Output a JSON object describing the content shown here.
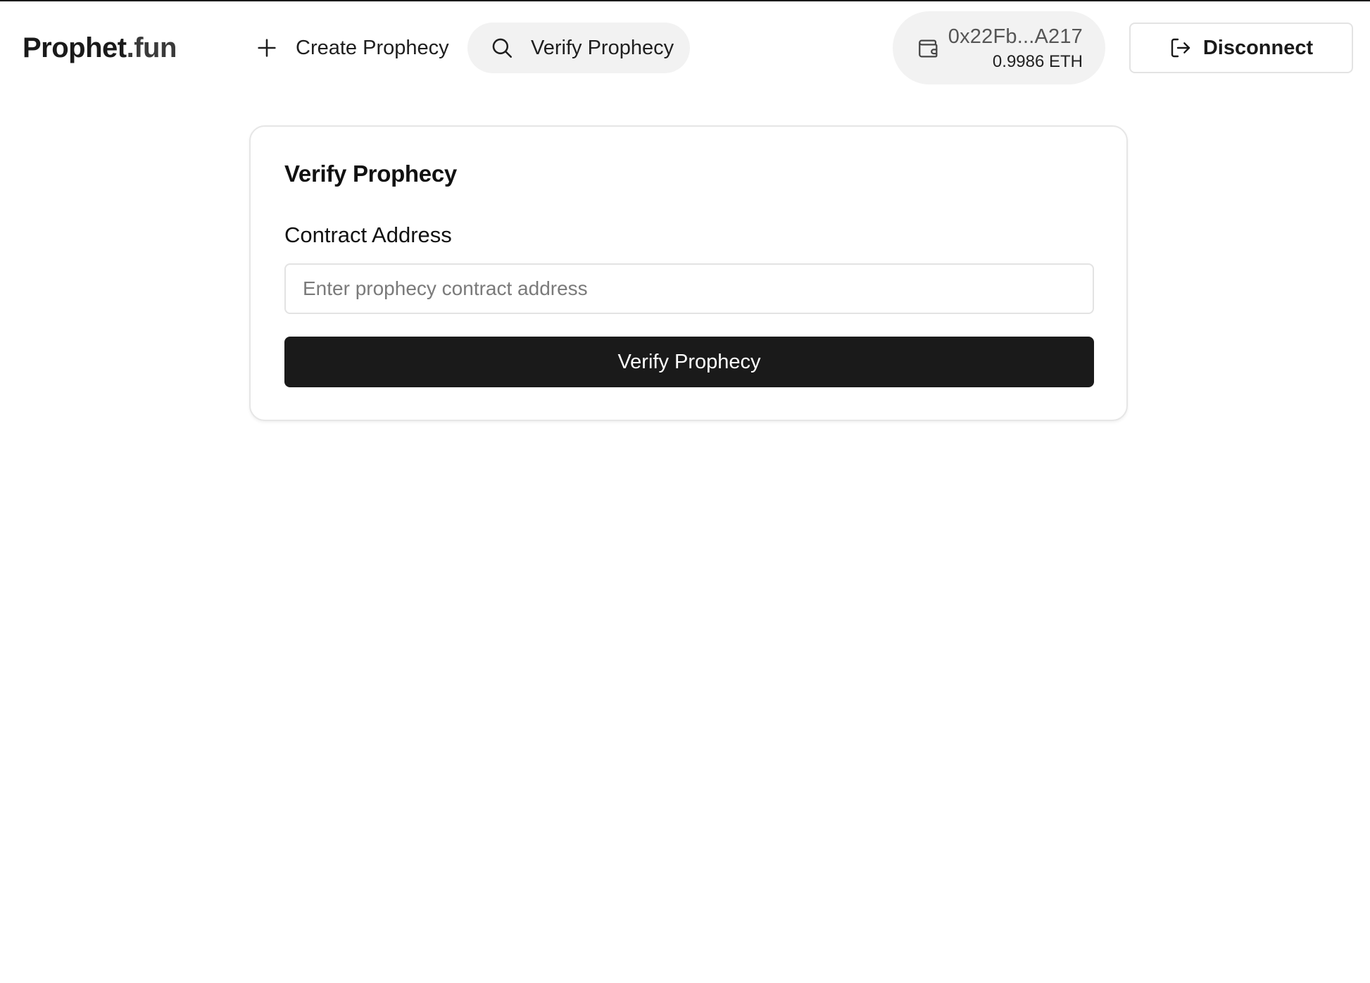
{
  "header": {
    "brand_main": "Prophet",
    "brand_suffix": ".fun",
    "nav": {
      "create_label": "Create Prophecy",
      "verify_label": "Verify Prophecy"
    },
    "wallet": {
      "address": "0x22Fb...A217",
      "balance": "0.9986 ETH"
    },
    "disconnect_label": "Disconnect"
  },
  "verify_card": {
    "title": "Verify Prophecy",
    "field_label": "Contract Address",
    "input_value": "",
    "input_placeholder": "Enter prophecy contract address",
    "submit_label": "Verify Prophecy"
  },
  "icons": {
    "create": "plus-icon",
    "verify": "search-icon",
    "wallet": "wallet-icon",
    "disconnect": "logout-icon"
  },
  "colors": {
    "primary_button": "#1a1a1a",
    "pill_background": "#f2f2f2",
    "border": "#e3e3e3"
  }
}
